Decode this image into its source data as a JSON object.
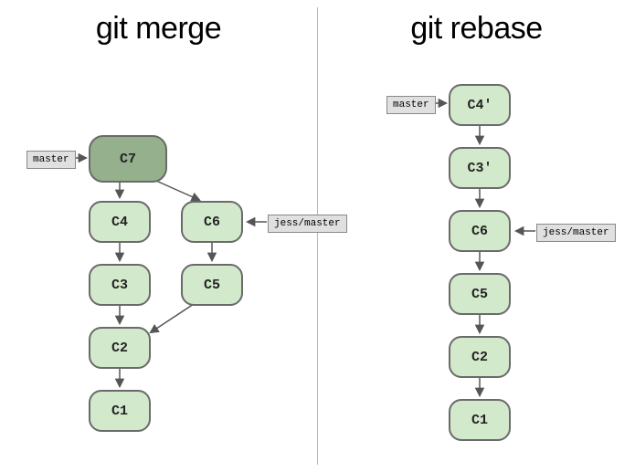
{
  "merge": {
    "title": "git merge",
    "master_ref": "master",
    "jess_ref": "jess/master",
    "commits": {
      "c7": "C7",
      "c4": "C4",
      "c3": "C3",
      "c2": "C2",
      "c1": "C1",
      "c6": "C6",
      "c5": "C5"
    }
  },
  "rebase": {
    "title": "git rebase",
    "master_ref": "master",
    "jess_ref": "jess/master",
    "commits": {
      "c4p": "C4'",
      "c3p": "C3'",
      "c6": "C6",
      "c5": "C5",
      "c2": "C2",
      "c1": "C1"
    }
  },
  "colors": {
    "commit_fill": "#d3e9cc",
    "merge_fill": "#95b08c",
    "ref_fill": "#e0e0e0"
  }
}
